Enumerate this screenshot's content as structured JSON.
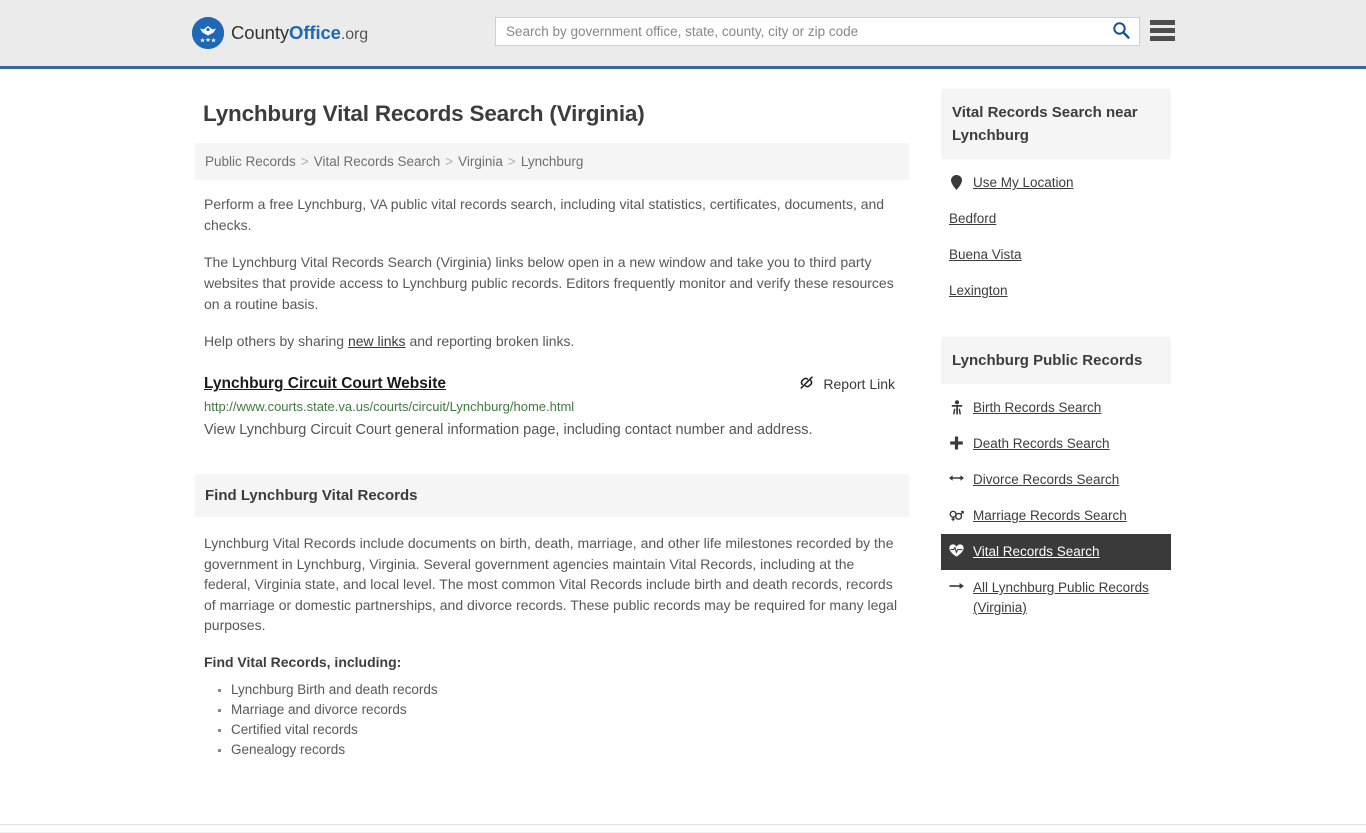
{
  "header": {
    "brand": {
      "part1": "County",
      "part2": "Office",
      "part3": ".org",
      "logo_icon": "eagle-seal-icon"
    },
    "search": {
      "placeholder": "Search by government office, state, county, city or zip code",
      "value": "",
      "icon": "search-icon"
    },
    "menu_icon": "hamburger-menu-icon",
    "accent_color": "#33699c",
    "background_color": "#ebebeb"
  },
  "page": {
    "title": "Lynchburg Vital Records Search (Virginia)"
  },
  "breadcrumb": {
    "items": [
      {
        "label": "Public Records"
      },
      {
        "label": "Vital Records Search"
      },
      {
        "label": "Virginia"
      },
      {
        "label": "Lynchburg"
      }
    ],
    "separator": ">"
  },
  "intro": {
    "paragraph1": "Perform a free Lynchburg, VA public vital records search, including vital statistics, certificates, documents, and checks.",
    "paragraph2": "The Lynchburg Vital Records Search (Virginia) links below open in a new window and take you to third party websites that provide access to Lynchburg public records. Editors frequently monitor and verify these resources on a routine basis.",
    "paragraph3_before": "Help others by sharing ",
    "paragraph3_link": "new links",
    "paragraph3_after": " and reporting broken links."
  },
  "result": {
    "title": "Lynchburg Circuit Court Website",
    "url": "http://www.courts.state.va.us/courts/circuit/Lynchburg/home.html",
    "description": "View Lynchburg Circuit Court general information page, including contact number and address.",
    "report_label": "Report Link",
    "report_icon": "broken-link-icon",
    "url_color": "#3f7b3f"
  },
  "find_section": {
    "heading": "Find Lynchburg Vital Records",
    "paragraph": "Lynchburg Vital Records include documents on birth, death, marriage, and other life milestones recorded by the government in Lynchburg, Virginia. Several government agencies maintain Vital Records, including at the federal, Virginia state, and local level. The most common Vital Records include birth and death records, records of marriage or domestic partnerships, and divorce records. These public records may be required for many legal purposes.",
    "list_lead": "Find Vital Records, including:",
    "items": [
      "Lynchburg Birth and death records",
      "Marriage and divorce records",
      "Certified vital records",
      "Genealogy records"
    ]
  },
  "sidebar": {
    "near": {
      "heading": "Vital Records Search near Lynchburg",
      "items": [
        {
          "label": "Use My Location",
          "icon": "map-pin-icon",
          "has_icon": true
        },
        {
          "label": "Bedford",
          "icon": "",
          "has_icon": false
        },
        {
          "label": "Buena Vista",
          "icon": "",
          "has_icon": false
        },
        {
          "label": "Lexington",
          "icon": "",
          "has_icon": false
        }
      ]
    },
    "public_records": {
      "heading": "Lynchburg Public Records",
      "items": [
        {
          "label": "Birth Records Search",
          "icon": "baby-icon",
          "active": false
        },
        {
          "label": "Death Records Search",
          "icon": "cross-icon",
          "active": false
        },
        {
          "label": "Divorce Records Search",
          "icon": "left-right-arrows-icon",
          "active": false
        },
        {
          "label": "Marriage Records Search",
          "icon": "venus-mars-icon",
          "active": false
        },
        {
          "label": "Vital Records Search",
          "icon": "heartbeat-icon",
          "active": true
        },
        {
          "label": "All Lynchburg Public Records (Virginia)",
          "icon": "arrow-right-icon",
          "active": false
        }
      ],
      "active_background": "#3a3a3a"
    }
  }
}
